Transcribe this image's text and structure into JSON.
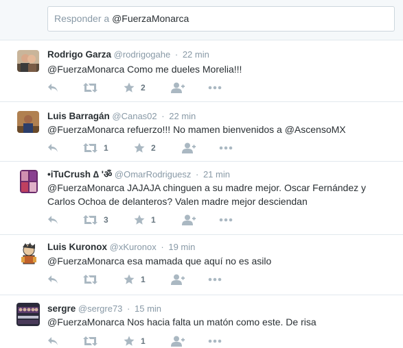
{
  "reply": {
    "prefix": "Responder a",
    "handle": "@FuerzaMonarca"
  },
  "tweets": [
    {
      "name": "Rodrigo Garza",
      "handle": "@rodrigogahe",
      "sep": "·",
      "time": "22 min",
      "mention": "@FuerzaMonarca",
      "text": " Como me dueles Morelia!!!",
      "retweets": "",
      "favorites": "2"
    },
    {
      "name": "Luis Barragán",
      "handle": "@Canas02",
      "sep": "·",
      "time": "22 min",
      "mention": "@FuerzaMonarca",
      "text": " refuerzo!!! No mamen bienvenidos a @AscensoMX",
      "retweets": "1",
      "favorites": "2"
    },
    {
      "name": "•iTuCrush ∆ 'ॐ",
      "handle": "@OmarRodriguesz",
      "sep": "·",
      "time": "21 min",
      "mention": "@FuerzaMonarca",
      "text": " JAJAJA chinguen a su madre mejor. Oscar Fernández y Carlos Ochoa de delanteros? Valen madre mejor desciendan",
      "retweets": "3",
      "favorites": "1"
    },
    {
      "name": "Luis Kuronox",
      "handle": "@xKuronox",
      "sep": "·",
      "time": "19 min",
      "mention": "@FuerzaMonarca",
      "text": " esa mamada que aquí no es asilo",
      "retweets": "",
      "favorites": "1"
    },
    {
      "name": "sergre",
      "handle": "@sergre73",
      "sep": "·",
      "time": "15 min",
      "mention": "@FuerzaMonarca",
      "text": " Nos hacia falta un matón como este. De risa",
      "retweets": "",
      "favorites": "1"
    }
  ],
  "icons": {
    "reply": "reply-icon",
    "retweet": "retweet-icon",
    "favorite": "star-icon",
    "follow": "follow-icon",
    "more": "more-icon"
  },
  "colors": {
    "icon": "#aab8c2",
    "muted": "#8899a6",
    "text": "#292f33",
    "border": "#e1e8ed",
    "reply_bg": "#f5f8fa"
  }
}
